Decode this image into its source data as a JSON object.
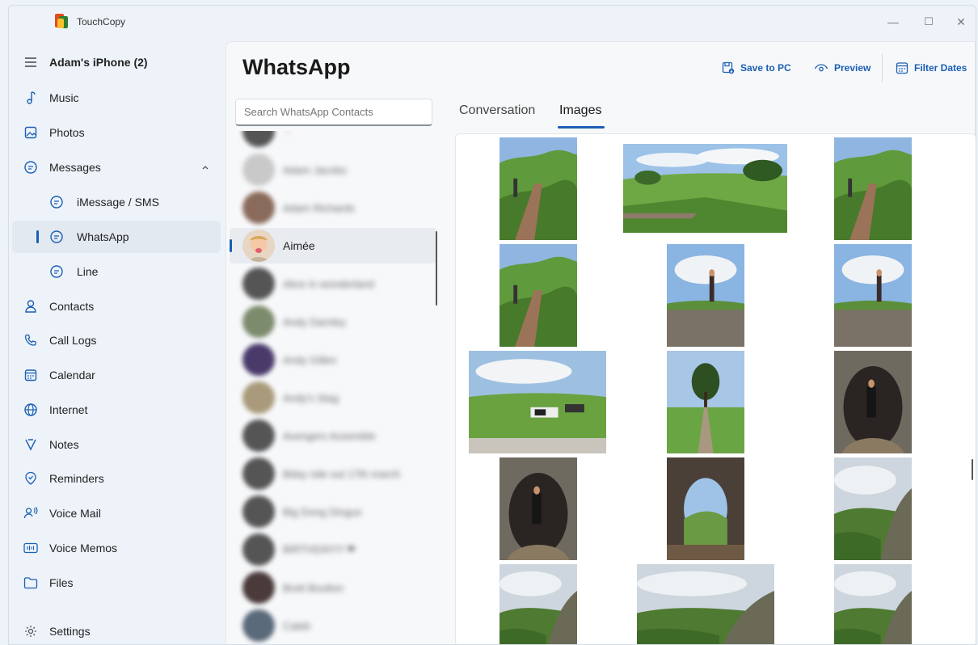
{
  "window": {
    "app_title": "TouchCopy",
    "minimize_glyph": "—",
    "maximize_glyph": "☐",
    "close_glyph": "✕"
  },
  "sidebar": {
    "device": "Adam's iPhone (2)",
    "items": [
      {
        "label": "Music",
        "icon": "music-note-icon"
      },
      {
        "label": "Photos",
        "icon": "photo-icon"
      },
      {
        "label": "Messages",
        "icon": "chat-bubble-icon"
      },
      {
        "label": "iMessage / SMS",
        "icon": "chat-bubble-icon"
      },
      {
        "label": "WhatsApp",
        "icon": "chat-bubble-icon"
      },
      {
        "label": "Line",
        "icon": "chat-bubble-icon"
      },
      {
        "label": "Contacts",
        "icon": "person-icon"
      },
      {
        "label": "Call Logs",
        "icon": "phone-icon"
      },
      {
        "label": "Calendar",
        "icon": "calendar-icon"
      },
      {
        "label": "Internet",
        "icon": "globe-icon"
      },
      {
        "label": "Notes",
        "icon": "pen-icon"
      },
      {
        "label": "Reminders",
        "icon": "reminder-check-icon"
      },
      {
        "label": "Voice Mail",
        "icon": "voicemail-person-icon"
      },
      {
        "label": "Voice Memos",
        "icon": "voice-memo-icon"
      },
      {
        "label": "Files",
        "icon": "folder-icon"
      },
      {
        "label": "Settings",
        "icon": "gear-icon"
      }
    ]
  },
  "main": {
    "title": "WhatsApp",
    "toolbar": {
      "save": "Save to PC",
      "preview": "Preview",
      "filter": "Filter Dates"
    },
    "search": {
      "placeholder": "Search WhatsApp Contacts"
    },
    "contacts": [
      {
        "name": "♡",
        "blurred": true
      },
      {
        "name": "Adam Jacobs",
        "blurred": true
      },
      {
        "name": "Adam Richards",
        "blurred": true
      },
      {
        "name": "Aimée",
        "blurred": false,
        "selected": true
      },
      {
        "name": "Alice in wonderland",
        "blurred": true
      },
      {
        "name": "Andy Darnley",
        "blurred": true
      },
      {
        "name": "Andy Gillen",
        "blurred": true
      },
      {
        "name": "Andy's Stag",
        "blurred": true
      },
      {
        "name": "Avengers Assemble",
        "blurred": true
      },
      {
        "name": "Bday ride out 17th march",
        "blurred": true
      },
      {
        "name": "Big Dong Dingus",
        "blurred": true
      },
      {
        "name": "BIRTHDAY!!! ❤",
        "blurred": true
      },
      {
        "name": "Brett Boulton",
        "blurred": true
      },
      {
        "name": "Caleb",
        "blurred": true
      }
    ],
    "tabs": [
      {
        "label": "Conversation"
      },
      {
        "label": "Images",
        "selected": true
      }
    ]
  },
  "colors": {
    "accent": "#1a5fb4",
    "window_bg": "#eef3f9",
    "panel_bg": "#f7f8fa"
  }
}
